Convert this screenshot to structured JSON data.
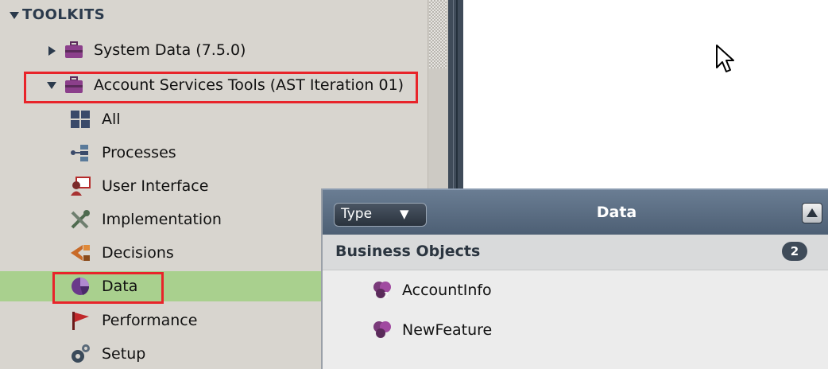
{
  "tree": {
    "section_label": "TOOLKITS",
    "items": [
      {
        "label": "System Data (7.5.0)",
        "icon": "toolbox-icon",
        "expander": "collapsed"
      },
      {
        "label": "Account Services Tools (AST Iteration 01)",
        "icon": "toolbox-icon",
        "expander": "expanded",
        "highlighted": true
      },
      {
        "label": "All",
        "icon": "grid-icon"
      },
      {
        "label": "Processes",
        "icon": "process-icon"
      },
      {
        "label": "User Interface",
        "icon": "user-interface-icon"
      },
      {
        "label": "Implementation",
        "icon": "tools-icon"
      },
      {
        "label": "Decisions",
        "icon": "decision-icon"
      },
      {
        "label": "Data",
        "icon": "data-pie-icon",
        "selected": true,
        "highlighted": true
      },
      {
        "label": "Performance",
        "icon": "flag-icon"
      },
      {
        "label": "Setup",
        "icon": "gears-icon"
      }
    ]
  },
  "data_panel": {
    "type_dropdown": "Type",
    "title": "Data",
    "group": {
      "label": "Business Objects",
      "count": "2"
    },
    "items": [
      {
        "label": "AccountInfo",
        "icon": "business-object-icon"
      },
      {
        "label": "NewFeature",
        "icon": "business-object-icon"
      }
    ]
  },
  "colors": {
    "tree_bg": "#d8d5cf",
    "selected_row": "#a9d08e",
    "highlight_box": "#e8242a",
    "panel_header": "#4c5e73"
  }
}
